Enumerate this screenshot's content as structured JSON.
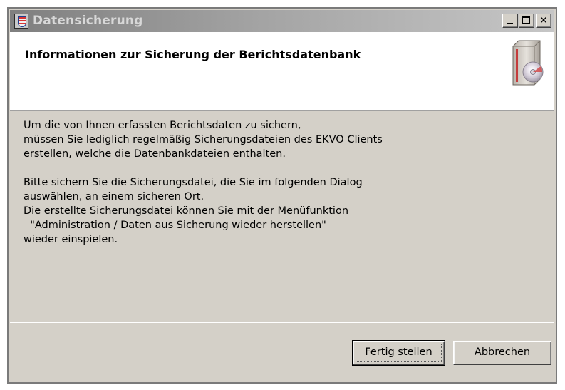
{
  "window": {
    "title": "Datensicherung",
    "controls": {
      "minimize": "minimize",
      "maximize": "maximize",
      "close": "close"
    }
  },
  "header": {
    "title": "Informationen zur Sicherung der Berichtsdatenbank",
    "graphic": "backup-disk-icon"
  },
  "body": {
    "paragraph1": [
      "Um die von Ihnen erfassten Berichtsdaten zu sichern,",
      "müssen Sie lediglich regelmäßig Sicherungsdateien des EKVO Clients",
      "erstellen, welche die Datenbankdateien enthalten."
    ],
    "paragraph2": [
      "Bitte sichern Sie die Sicherungsdatei, die Sie im folgenden Dialog",
      "auswählen, an einem sicheren Ort.",
      "Die erstellte Sicherungsdatei können Sie mit der Menüfunktion",
      "  \"Administration / Daten aus Sicherung wieder herstellen\"",
      "wieder einspielen."
    ]
  },
  "buttons": {
    "finish": "Fertig stellen",
    "cancel": "Abbrechen"
  },
  "colors": {
    "dialog_face": "#d4d0c8",
    "titlebar_start": "#7f7f7f",
    "titlebar_end": "#c6c6c6",
    "header_bg": "#ffffff"
  }
}
